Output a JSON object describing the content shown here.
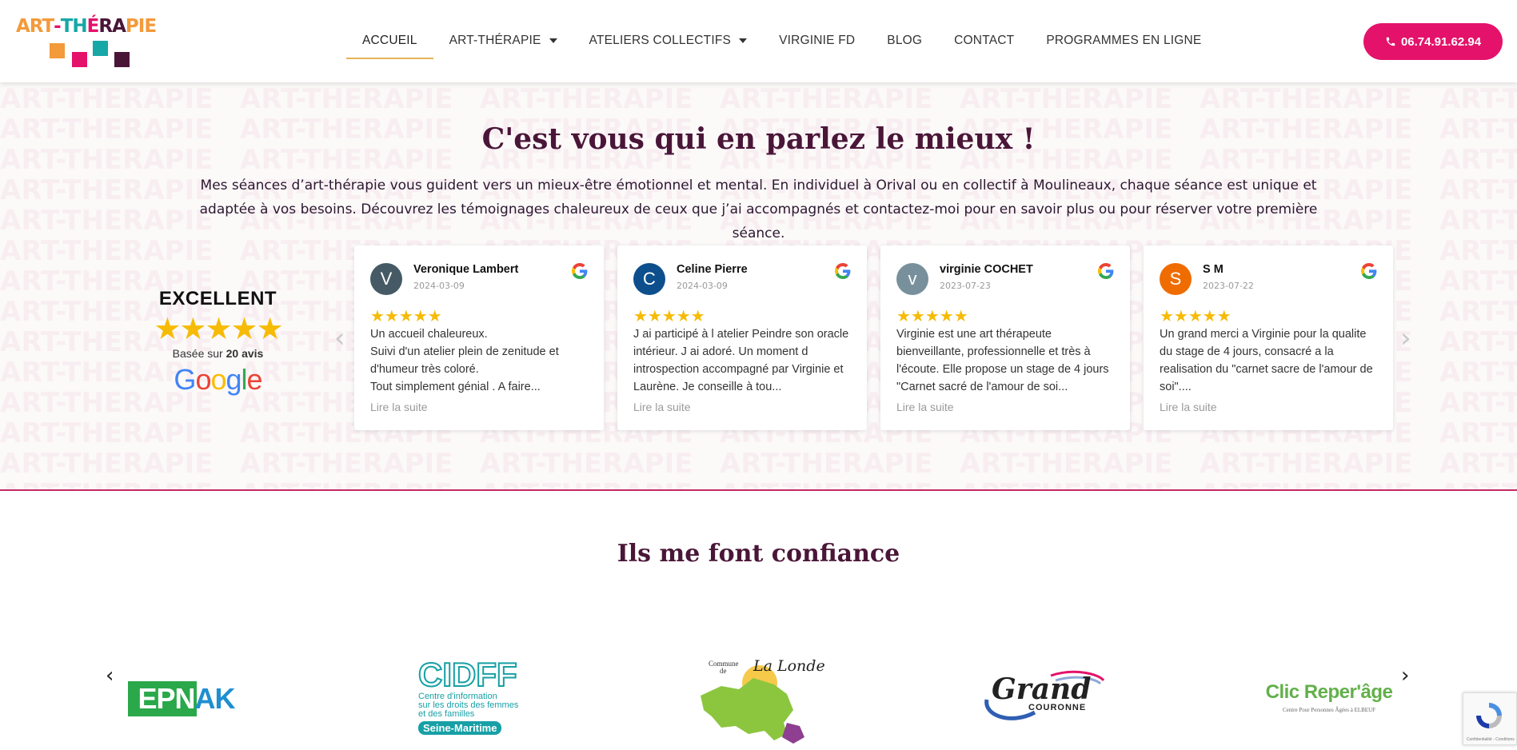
{
  "brand": {
    "logo_text": "ART-THÉRAPIE",
    "colors": {
      "orange": "#f39a3a",
      "pink": "#e4126a",
      "teal": "#17a7a7",
      "plum": "#4a1638",
      "gold": "#e7b456",
      "star": "#f6bb06"
    }
  },
  "nav": {
    "items": [
      {
        "label": "ACCUEIL",
        "active": true,
        "dropdown": false
      },
      {
        "label": "ART-THÉRAPIE",
        "active": false,
        "dropdown": true
      },
      {
        "label": "ATELIERS COLLECTIFS",
        "active": false,
        "dropdown": true
      },
      {
        "label": "VIRGINIE FD",
        "active": false,
        "dropdown": false
      },
      {
        "label": "BLOG",
        "active": false,
        "dropdown": false
      },
      {
        "label": "CONTACT",
        "active": false,
        "dropdown": false
      },
      {
        "label": "PROGRAMMES EN LIGNE",
        "active": false,
        "dropdown": false
      }
    ],
    "phone": "06.74.91.62.94",
    "phone_icon": "phone-icon"
  },
  "testimonials": {
    "title": "C'est vous qui en parlez le mieux !",
    "intro": "Mes séances d’art-thérapie vous guident vers un mieux-être émotionnel et mental. En individuel à Orival ou en collectif à Moulineaux, chaque séance est unique et adaptée à vos besoins. Découvrez les témoignages chaleureux de ceux que j’ai accompagnés et contactez-moi pour en savoir plus ou pour réserver votre première séance.",
    "badge": {
      "rating_label": "EXCELLENT",
      "stars": "★★★★★",
      "based_on": "Basée sur ",
      "count": "20 avis",
      "provider": "Google"
    },
    "prev_arrow": "‹",
    "next_arrow": "›",
    "reviews": [
      {
        "initial": "V",
        "avatar_color": "#455a64",
        "name": "Veronique Lambert",
        "date": "2024-03-09",
        "stars": "★★★★★",
        "text": "Un accueil chaleureux.\nSuivi d'un atelier plein de zenitude et d'humeur très coloré.\nTout simplement génial . A faire...",
        "more": "Lire la suite"
      },
      {
        "initial": "C",
        "avatar_color": "#0d4f8c",
        "name": "Celine Pierre",
        "date": "2024-03-09",
        "stars": "★★★★★",
        "text": "J ai participé à l atelier Peindre son oracle intérieur. J ai adoré. Un moment d introspection accompagné par Virginie et Laurène. Je conseille à tou...",
        "more": "Lire la suite"
      },
      {
        "initial": "v",
        "avatar_color": "#78909c",
        "name": "virginie COCHET",
        "date": "2023-07-23",
        "stars": "★★★★★",
        "text": "Virginie est une art thérapeute bienveillante, professionnelle et très à l'écoute. Elle propose un stage de 4 jours \"Carnet sacré de l'amour de soi...",
        "more": "Lire la suite"
      },
      {
        "initial": "S",
        "avatar_color": "#ef6c00",
        "name": "S M",
        "date": "2023-07-22",
        "stars": "★★★★★",
        "text": "Un grand merci a Virginie pour la qualite du stage de 4 jours, consacré a la realisation du \"carnet sacre de l'amour de soi\"....",
        "more": "Lire la suite"
      }
    ]
  },
  "partners": {
    "title": "Ils me font confiance",
    "prev_arrow": "‹",
    "next_arrow": "›",
    "logos": {
      "epnak": "EPNAK",
      "cidff": {
        "name": "CIDFF",
        "line1": "Centre d'information",
        "line2": "sur les droits des femmes",
        "line3": "et des familles",
        "region": "Seine-Maritime"
      },
      "lalonde": {
        "prefix_1": "Commune",
        "prefix_2": "de",
        "name": "La Londe"
      },
      "grandcouronne": {
        "word1": "Grand",
        "word2": "COURONNE"
      },
      "clic": {
        "name": "Clic Reper'âge",
        "sub": "Centre Pour Personnes Âgées à ELBEUF"
      }
    }
  },
  "recaptcha": {
    "text": "Confidentialité - Conditions"
  }
}
